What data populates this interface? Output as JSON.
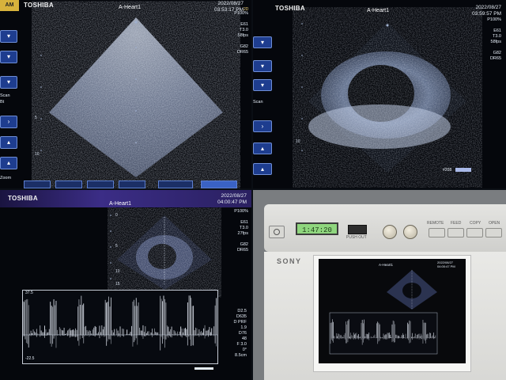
{
  "panels": [
    {
      "brand": "TOSHIBA",
      "title": "A-Heart1",
      "date_line1": "2022/08/27",
      "date_line2": "03:53:17 PM",
      "mode": "2D",
      "params": "P100%\n\nE61\nT3.0\n58fps\n\nG82\nDR65",
      "side_labels": [
        "Scan",
        "Bt",
        "Ti",
        "Zoom"
      ]
    },
    {
      "brand": "TOSHIBA",
      "title": "A-Heart1",
      "date_line1": "2022/08/27",
      "date_line2": "03:59:57 PM",
      "params": "P100%\n\nE61\nT3.0\n58fps\n\nG82\nDR65",
      "frame_label": "#208",
      "side_labels": [
        "Scan"
      ]
    },
    {
      "brand": "TOSHIBA",
      "title": "A-Heart1",
      "date_line1": "2022/08/27",
      "date_line2": "04:00:47 PM",
      "params": "P100%\n\nE61\nT3.0\n27fps\n\nG82\nDR65",
      "doppler_params": "D2.5\nD635\nD PRF\n1.9\nD76\n48\nF 3.0\n0°\n8.5cm",
      "doppler_scale_top": "37.5",
      "doppler_scale_bottom": "-22.5",
      "depth_marks": [
        "0",
        "5",
        "10",
        "15"
      ]
    },
    {
      "brand": "SONY",
      "lcd": "1:47:20",
      "labels": [
        "PUSH OUT",
        "REMOTE",
        "FEED",
        "COPY",
        "OPEN"
      ],
      "print": {
        "title": "A-Heart1",
        "date_line1": "2022/08/27",
        "date_line2": "04:00:47 PM"
      }
    }
  ],
  "colors": {
    "toolbar_blue": "#1e3d8f",
    "lcd_green": "#8fd67e",
    "ultrasound_white": "#dfe6f0"
  }
}
